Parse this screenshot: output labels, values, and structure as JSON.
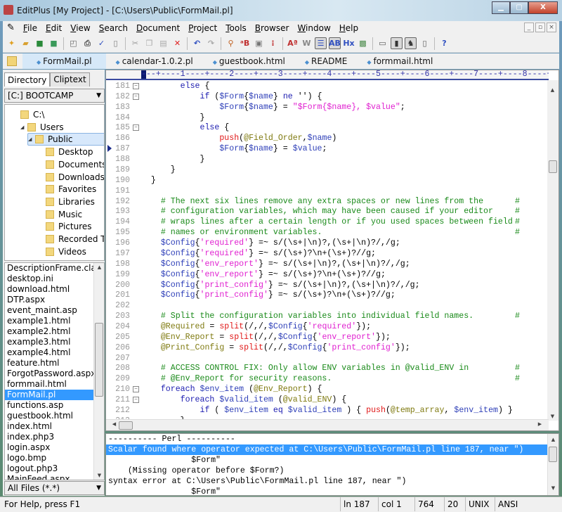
{
  "window": {
    "title": "EditPlus [My Project] - [C:\\Users\\Public\\FormMail.pl]",
    "minimize": "▁",
    "maximize": "▢",
    "close": "X"
  },
  "menu": {
    "items": [
      {
        "label": "File",
        "u": "F"
      },
      {
        "label": "Edit",
        "u": "E"
      },
      {
        "label": "View",
        "u": "V"
      },
      {
        "label": "Search",
        "u": "S"
      },
      {
        "label": "Document",
        "u": "D"
      },
      {
        "label": "Project",
        "u": "P"
      },
      {
        "label": "Tools",
        "u": "T"
      },
      {
        "label": "Browser",
        "u": "B"
      },
      {
        "label": "Window",
        "u": "W"
      },
      {
        "label": "Help",
        "u": "H"
      }
    ],
    "mdi": [
      "_",
      "▫",
      "×"
    ]
  },
  "toolbar": [
    {
      "icon": "new-file-icon",
      "glyph": "✦",
      "color": "#e0a020"
    },
    {
      "icon": "open-icon",
      "glyph": "▰",
      "color": "#d8a030"
    },
    {
      "icon": "save-icon",
      "glyph": "■",
      "color": "#2a8a3a"
    },
    {
      "icon": "save-all-icon",
      "glyph": "■",
      "color": "#3a9a5a"
    },
    {
      "sep": true
    },
    {
      "icon": "print-preview-icon",
      "glyph": "◰",
      "color": "#666"
    },
    {
      "icon": "print-icon",
      "glyph": "⎙",
      "color": "#555"
    },
    {
      "icon": "spell-check-icon",
      "glyph": "✓",
      "color": "#3050c0"
    },
    {
      "icon": "html-preview-icon",
      "glyph": "▯",
      "color": "#777"
    },
    {
      "sep": true
    },
    {
      "icon": "cut-icon",
      "glyph": "✂",
      "color": "#999"
    },
    {
      "icon": "copy-icon",
      "glyph": "❐",
      "color": "#aaa"
    },
    {
      "icon": "paste-icon",
      "glyph": "▤",
      "color": "#aaa"
    },
    {
      "icon": "delete-icon",
      "glyph": "✕",
      "color": "#e02020"
    },
    {
      "sep": true
    },
    {
      "icon": "undo-icon",
      "glyph": "↶",
      "color": "#3050c0"
    },
    {
      "icon": "redo-icon",
      "glyph": "↷",
      "color": "#aaa"
    },
    {
      "sep": true
    },
    {
      "icon": "find-icon",
      "glyph": "⚲",
      "color": "#c06020"
    },
    {
      "icon": "replace-icon",
      "glyph": "ᵃB",
      "color": "#c03030"
    },
    {
      "icon": "goto-icon",
      "glyph": "▣",
      "color": "#777"
    },
    {
      "icon": "line-numbers-icon",
      "glyph": "⁝",
      "color": "#c03030"
    },
    {
      "sep": true
    },
    {
      "icon": "font-size-icon",
      "glyph": "Aª",
      "color": "#c03030"
    },
    {
      "icon": "word-wrap-icon",
      "glyph": "W",
      "color": "#888"
    },
    {
      "icon": "ruler-icon",
      "glyph": "☰",
      "color": "#3050c0",
      "on": true
    },
    {
      "icon": "column-select-icon",
      "glyph": "AB",
      "color": "#3050c0",
      "on": true
    },
    {
      "icon": "hex-view-icon",
      "glyph": "Hx",
      "color": "#3050c0"
    },
    {
      "icon": "screen-icon",
      "glyph": "▩",
      "color": "#4a8a4a"
    },
    {
      "sep": true
    },
    {
      "icon": "output-window-icon",
      "glyph": "▭",
      "color": "#555"
    },
    {
      "icon": "directory-window-icon",
      "glyph": "▮",
      "color": "#333",
      "on": true
    },
    {
      "icon": "cliptext-window-icon",
      "glyph": "♞",
      "color": "#333",
      "on": true
    },
    {
      "icon": "fullscreen-icon",
      "glyph": "▯",
      "color": "#555"
    },
    {
      "sep": true
    },
    {
      "icon": "help-icon",
      "glyph": "?",
      "color": "#3050c0"
    }
  ],
  "tabs": [
    {
      "label": "FormMail.pl",
      "active": true
    },
    {
      "label": "calendar-1.0.2.pl"
    },
    {
      "label": "guestbook.html"
    },
    {
      "label": "README"
    },
    {
      "label": "formmail.html"
    }
  ],
  "left": {
    "tabs": [
      {
        "label": "Directory",
        "active": true
      },
      {
        "label": "Cliptext"
      }
    ],
    "drive": "[C:] BOOTCAMP",
    "tree": [
      {
        "label": "C:\\",
        "level": 0
      },
      {
        "label": "Users",
        "level": 1,
        "expanded": true
      },
      {
        "label": "Public",
        "level": 2,
        "expanded": true,
        "selected": true
      },
      {
        "label": "Desktop",
        "level": 3
      },
      {
        "label": "Documents",
        "level": 3
      },
      {
        "label": "Downloads",
        "level": 3
      },
      {
        "label": "Favorites",
        "level": 3
      },
      {
        "label": "Libraries",
        "level": 3
      },
      {
        "label": "Music",
        "level": 3
      },
      {
        "label": "Pictures",
        "level": 3
      },
      {
        "label": "Recorded TV",
        "level": 3
      },
      {
        "label": "Videos",
        "level": 3
      }
    ],
    "files": [
      "DescriptionFrame.class",
      "desktop.ini",
      "download.html",
      "DTP.aspx",
      "event_maint.asp",
      "example1.html",
      "example2.html",
      "example3.html",
      "example4.html",
      "feature.html",
      "ForgotPassword.aspx",
      "formmail.html",
      "FormMail.pl",
      "functions.asp",
      "guestbook.html",
      "index.html",
      "index.php3",
      "login.aspx",
      "logo.bmp",
      "logout.php3",
      "MainFeed.aspx"
    ],
    "selected_file": "FormMail.pl",
    "filter": "All Files (*.*)"
  },
  "ruler": "---+----1----+----2----+----3----+----4----+----5----+----6----+----7----+----8----+",
  "code": [
    {
      "n": "181",
      "fold": true,
      "t": [
        [
          "        ",
          "p"
        ],
        [
          "else",
          "k"
        ],
        [
          " {",
          "p"
        ]
      ]
    },
    {
      "n": "182",
      "fold": true,
      "t": [
        [
          "            ",
          "p"
        ],
        [
          "if",
          "k"
        ],
        [
          " (",
          "p"
        ],
        [
          "$Form",
          "v"
        ],
        [
          "{",
          "p"
        ],
        [
          "$name",
          "v"
        ],
        [
          "} ",
          "p"
        ],
        [
          "ne",
          "k"
        ],
        [
          " '') {",
          "p"
        ]
      ]
    },
    {
      "n": "183",
      "t": [
        [
          "                ",
          "p"
        ],
        [
          "$Form",
          "v"
        ],
        [
          "{",
          "p"
        ],
        [
          "$name",
          "v"
        ],
        [
          "} = ",
          "p"
        ],
        [
          "\"$Form{$name}, $value\"",
          "s"
        ],
        [
          ";",
          "p"
        ]
      ]
    },
    {
      "n": "184",
      "t": [
        [
          "            }",
          "p"
        ]
      ]
    },
    {
      "n": "185",
      "fold": true,
      "t": [
        [
          "            ",
          "p"
        ],
        [
          "else",
          "k"
        ],
        [
          " {",
          "p"
        ]
      ]
    },
    {
      "n": "186",
      "t": [
        [
          "                ",
          "p"
        ],
        [
          "push",
          "f"
        ],
        [
          "(",
          "p"
        ],
        [
          "@Field_Order",
          "a"
        ],
        [
          ",",
          "p"
        ],
        [
          "$name",
          "v"
        ],
        [
          ")",
          "p"
        ]
      ]
    },
    {
      "n": "187",
      "marker": true,
      "t": [
        [
          "                ",
          "p"
        ],
        [
          "$Form",
          "v"
        ],
        [
          "{",
          "p"
        ],
        [
          "$name",
          "v"
        ],
        [
          "} = ",
          "p"
        ],
        [
          "$value",
          "v"
        ],
        [
          ";",
          "p"
        ]
      ]
    },
    {
      "n": "188",
      "t": [
        [
          "            }",
          "p"
        ]
      ]
    },
    {
      "n": "189",
      "t": [
        [
          "      }",
          "p"
        ]
      ]
    },
    {
      "n": "190",
      "t": [
        [
          "  }",
          "p"
        ]
      ]
    },
    {
      "n": "191",
      "t": []
    },
    {
      "n": "192",
      "t": [
        [
          "    ",
          "p"
        ],
        [
          "# The next six lines remove any extra spaces or new lines from the",
          "c"
        ],
        [
          "#",
          "ce"
        ]
      ]
    },
    {
      "n": "193",
      "t": [
        [
          "    ",
          "p"
        ],
        [
          "# configuration variables, which may have been caused if your editor",
          "c"
        ],
        [
          "#",
          "ce"
        ]
      ]
    },
    {
      "n": "194",
      "t": [
        [
          "    ",
          "p"
        ],
        [
          "# wraps lines after a certain length or if you used spaces between field",
          "c"
        ],
        [
          "#",
          "ce"
        ]
      ]
    },
    {
      "n": "195",
      "t": [
        [
          "    ",
          "p"
        ],
        [
          "# names or environment variables.",
          "c"
        ],
        [
          "#",
          "ce"
        ]
      ]
    },
    {
      "n": "196",
      "t": [
        [
          "    ",
          "p"
        ],
        [
          "$Config",
          "v"
        ],
        [
          "{",
          "p"
        ],
        [
          "'required'",
          "s"
        ],
        [
          "} =~ s/(\\s+|\\n)?,(\\s+|\\n)?/,/g;",
          "p"
        ]
      ]
    },
    {
      "n": "197",
      "t": [
        [
          "    ",
          "p"
        ],
        [
          "$Config",
          "v"
        ],
        [
          "{",
          "p"
        ],
        [
          "'required'",
          "s"
        ],
        [
          "} =~ s/(\\s+)?\\n+(\\s+)?//g;",
          "p"
        ]
      ]
    },
    {
      "n": "198",
      "t": [
        [
          "    ",
          "p"
        ],
        [
          "$Config",
          "v"
        ],
        [
          "{",
          "p"
        ],
        [
          "'env_report'",
          "s"
        ],
        [
          "} =~ s/(\\s+|\\n)?,(\\s+|\\n)?/,/g;",
          "p"
        ]
      ]
    },
    {
      "n": "199",
      "t": [
        [
          "    ",
          "p"
        ],
        [
          "$Config",
          "v"
        ],
        [
          "{",
          "p"
        ],
        [
          "'env_report'",
          "s"
        ],
        [
          "} =~ s/(\\s+)?\\n+(\\s+)?//g;",
          "p"
        ]
      ]
    },
    {
      "n": "200",
      "t": [
        [
          "    ",
          "p"
        ],
        [
          "$Config",
          "v"
        ],
        [
          "{",
          "p"
        ],
        [
          "'print_config'",
          "s"
        ],
        [
          "} =~ s/(\\s+|\\n)?,(\\s+|\\n)?/,/g;",
          "p"
        ]
      ]
    },
    {
      "n": "201",
      "t": [
        [
          "    ",
          "p"
        ],
        [
          "$Config",
          "v"
        ],
        [
          "{",
          "p"
        ],
        [
          "'print_config'",
          "s"
        ],
        [
          "} =~ s/(\\s+)?\\n+(\\s+)?//g;",
          "p"
        ]
      ]
    },
    {
      "n": "202",
      "t": []
    },
    {
      "n": "203",
      "t": [
        [
          "    ",
          "p"
        ],
        [
          "# Split the configuration variables into individual field names.",
          "c"
        ],
        [
          "#",
          "ce"
        ]
      ]
    },
    {
      "n": "204",
      "t": [
        [
          "    ",
          "p"
        ],
        [
          "@Required",
          "a"
        ],
        [
          " = ",
          "p"
        ],
        [
          "split",
          "f"
        ],
        [
          "(/,/,",
          "p"
        ],
        [
          "$Config",
          "v"
        ],
        [
          "{",
          "p"
        ],
        [
          "'required'",
          "s"
        ],
        [
          "});",
          "p"
        ]
      ]
    },
    {
      "n": "205",
      "t": [
        [
          "    ",
          "p"
        ],
        [
          "@Env_Report",
          "a"
        ],
        [
          " = ",
          "p"
        ],
        [
          "split",
          "f"
        ],
        [
          "(/,/,",
          "p"
        ],
        [
          "$Config",
          "v"
        ],
        [
          "{",
          "p"
        ],
        [
          "'env_report'",
          "s"
        ],
        [
          "});",
          "p"
        ]
      ]
    },
    {
      "n": "206",
      "t": [
        [
          "    ",
          "p"
        ],
        [
          "@Print_Config",
          "a"
        ],
        [
          " = ",
          "p"
        ],
        [
          "split",
          "f"
        ],
        [
          "(/,/,",
          "p"
        ],
        [
          "$Config",
          "v"
        ],
        [
          "{",
          "p"
        ],
        [
          "'print_config'",
          "s"
        ],
        [
          "});",
          "p"
        ]
      ]
    },
    {
      "n": "207",
      "t": []
    },
    {
      "n": "208",
      "t": [
        [
          "    ",
          "p"
        ],
        [
          "# ACCESS CONTROL FIX: Only allow ENV variables in @valid_ENV in",
          "c"
        ],
        [
          "#",
          "ce"
        ]
      ]
    },
    {
      "n": "209",
      "t": [
        [
          "    ",
          "p"
        ],
        [
          "# @Env_Report for security reasons.",
          "c"
        ],
        [
          "#",
          "ce"
        ]
      ]
    },
    {
      "n": "210",
      "fold": true,
      "t": [
        [
          "    ",
          "p"
        ],
        [
          "foreach",
          "k"
        ],
        [
          " ",
          "p"
        ],
        [
          "$env_item",
          "v"
        ],
        [
          " (",
          "p"
        ],
        [
          "@Env_Report",
          "a"
        ],
        [
          ") {",
          "p"
        ]
      ]
    },
    {
      "n": "211",
      "fold": true,
      "t": [
        [
          "        ",
          "p"
        ],
        [
          "foreach",
          "k"
        ],
        [
          " ",
          "p"
        ],
        [
          "$valid_item",
          "v"
        ],
        [
          " (",
          "p"
        ],
        [
          "@valid_ENV",
          "a"
        ],
        [
          ") {",
          "p"
        ]
      ]
    },
    {
      "n": "212",
      "t": [
        [
          "            ",
          "p"
        ],
        [
          "if",
          "k"
        ],
        [
          " ( ",
          "p"
        ],
        [
          "$env_item",
          "v"
        ],
        [
          " ",
          "p"
        ],
        [
          "eq",
          "k"
        ],
        [
          " ",
          "p"
        ],
        [
          "$valid_item",
          "v"
        ],
        [
          " ) { ",
          "p"
        ],
        [
          "push",
          "f"
        ],
        [
          "(",
          "p"
        ],
        [
          "@temp_array",
          "a"
        ],
        [
          ", ",
          "p"
        ],
        [
          "$env_item",
          "v"
        ],
        [
          ") }",
          "p"
        ]
      ]
    },
    {
      "n": "213",
      "t": [
        [
          "        }",
          "p"
        ]
      ]
    }
  ],
  "output": {
    "lines": [
      "---------- Perl ----------",
      "Scalar found where operator expected at C:\\Users\\Public\\FormMail.pl line 187, near \")",
      "                 $Form\"",
      "    (Missing operator before $Form?)",
      "syntax error at C:\\Users\\Public\\FormMail.pl line 187, near \")",
      "                 $Form\""
    ],
    "selected": 1
  },
  "status": {
    "help": "For Help, press F1",
    "line": "ln 187",
    "col": "col 1",
    "chars": "764",
    "cell": "20",
    "eol": "UNIX",
    "encoding": "ANSI"
  }
}
